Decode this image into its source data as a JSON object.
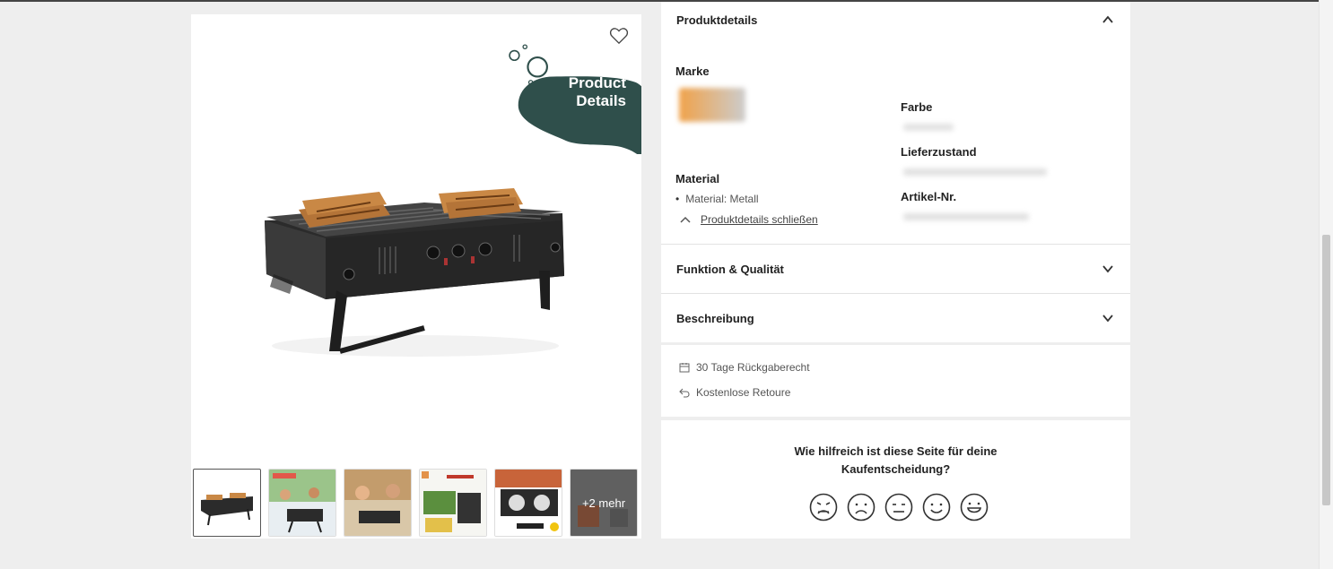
{
  "badge": {
    "line1": "Product",
    "line2": "Details"
  },
  "thumbnails": {
    "more_label": "+2 mehr"
  },
  "product_details": {
    "header": "Produktdetails",
    "marke_label": "Marke",
    "farbe_label": "Farbe",
    "lieferzustand_label": "Lieferzustand",
    "material_label": "Material",
    "material_item": "Material: Metall",
    "artikel_label": "Artikel-Nr.",
    "close_link": "Produktdetails schließen"
  },
  "accordion": {
    "funktion": "Funktion & Qualität",
    "beschreibung": "Beschreibung"
  },
  "info": {
    "return_right": "30 Tage Rückgaberecht",
    "free_return": "Kostenlose Retoure"
  },
  "feedback": {
    "question_line1": "Wie hilfreich ist diese Seite für deine",
    "question_line2": "Kaufentscheidung?"
  },
  "colors": {
    "badge": "#2f4f4b",
    "background": "#eeeeee"
  }
}
